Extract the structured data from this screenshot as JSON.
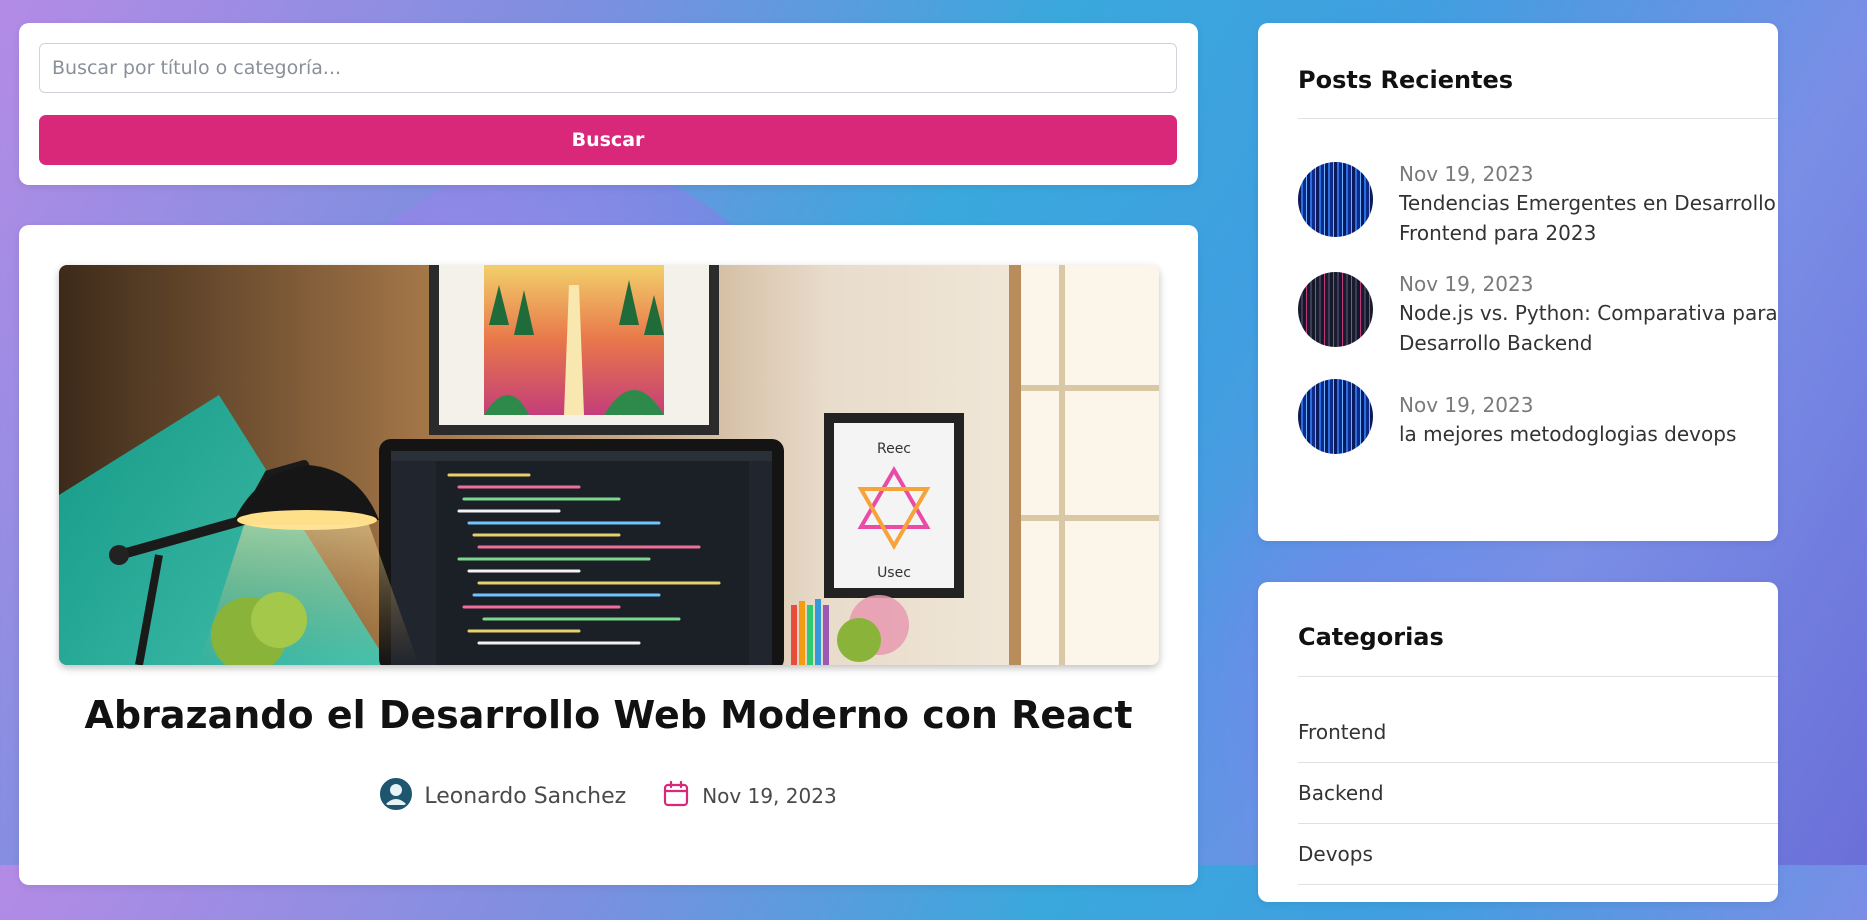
{
  "search": {
    "placeholder": "Buscar por título o categoría...",
    "button_label": "Buscar"
  },
  "post": {
    "title": "Abrazando el Desarrollo Web Moderno con React",
    "author": "Leonardo Sanchez",
    "date": "Nov 19, 2023",
    "image": {
      "art_sign_top": "Reec",
      "art_sign_bottom": "Usec"
    }
  },
  "recent": {
    "title": "Posts Recientes",
    "items": [
      {
        "date": "Nov 19, 2023",
        "title": "Tendencias Emergentes en Desarrollo Frontend para 2023"
      },
      {
        "date": "Nov 19, 2023",
        "title": "Node.js vs. Python: Comparativa para Desarrollo Backend"
      },
      {
        "date": "Nov 19, 2023",
        "title": "la mejores metodoglogias devops"
      }
    ]
  },
  "categories": {
    "title": "Categorias",
    "items": [
      "Frontend",
      "Backend",
      "Devops"
    ]
  },
  "colors": {
    "accent": "#d9287a",
    "card_bg": "#ffffff"
  },
  "icons": {
    "author": "user-avatar-icon",
    "date": "calendar-icon"
  }
}
